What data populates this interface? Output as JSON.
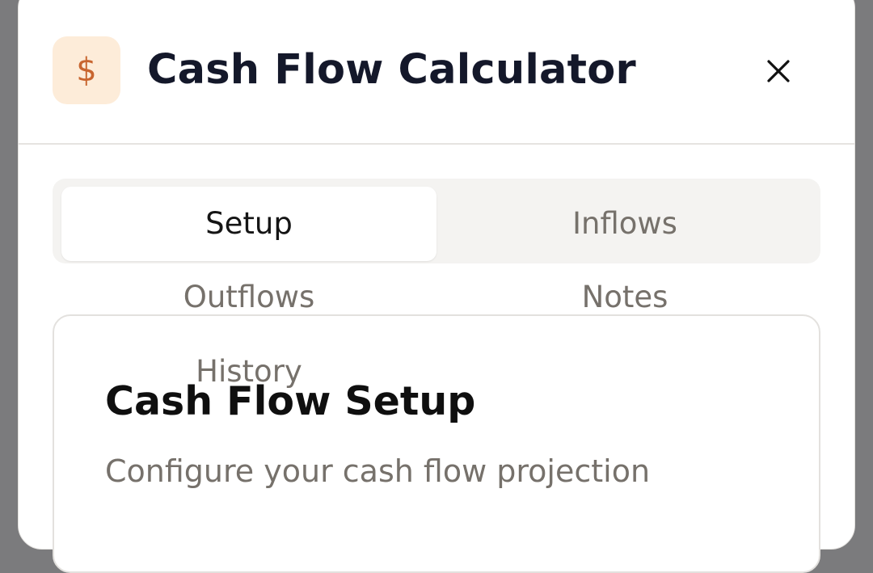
{
  "dialog": {
    "icon_glyph": "$",
    "icon_name": "dollar-icon",
    "title": "Cash Flow Calculator",
    "close_icon": "close-icon"
  },
  "tabs": [
    {
      "label": "Setup",
      "selected": true
    },
    {
      "label": "Inflows",
      "selected": false
    },
    {
      "label": "Outflows",
      "selected": false
    },
    {
      "label": "Notes",
      "selected": false
    },
    {
      "label": "History",
      "selected": false
    }
  ],
  "panel": {
    "title": "Cash Flow Setup",
    "subtitle": "Configure your cash flow projection"
  },
  "colors": {
    "accent": "#c8652f",
    "accent_bg": "#fdecd9",
    "title_text": "#14182a",
    "muted_text": "#76716b",
    "overlay": "#7b7b7d"
  }
}
